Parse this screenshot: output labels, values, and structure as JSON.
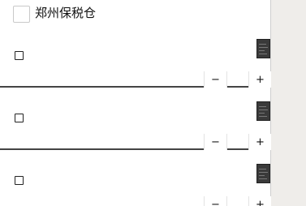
{
  "store": {
    "name": "郑州保税仓"
  },
  "stepper": {
    "minus": "−",
    "plus": "+"
  },
  "items": [
    {
      "thumb_icon": "product-thumbnail",
      "qty": ""
    },
    {
      "thumb_icon": "product-thumbnail",
      "qty": ""
    },
    {
      "thumb_icon": "product-thumbnail",
      "qty": ""
    }
  ],
  "colors": {
    "page_bg": "#efedea",
    "panel_bg": "#ffffff",
    "divider": "#444444",
    "thumbnail": "#3a3a3a"
  }
}
